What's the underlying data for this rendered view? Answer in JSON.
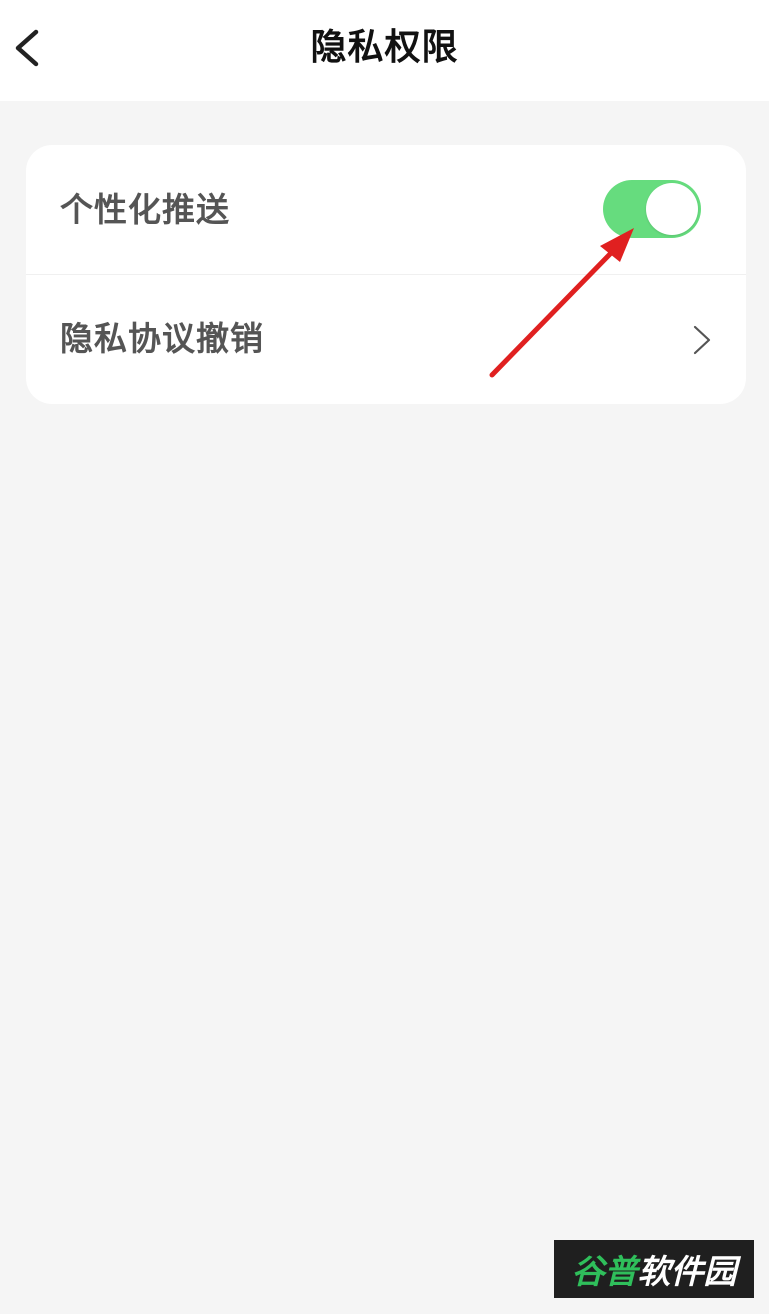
{
  "header": {
    "title": "隐私权限",
    "back_icon": "chevron-left-icon"
  },
  "settings": {
    "personalized_push": {
      "label": "个性化推送",
      "enabled": true,
      "toggle_color": "#66dc7e"
    },
    "privacy_revoke": {
      "label": "隐私协议撤销",
      "icon": "chevron-right-icon"
    }
  },
  "annotation": {
    "arrow_color": "#e02020"
  },
  "watermark": {
    "part1": "谷普",
    "part2": "软件园"
  }
}
